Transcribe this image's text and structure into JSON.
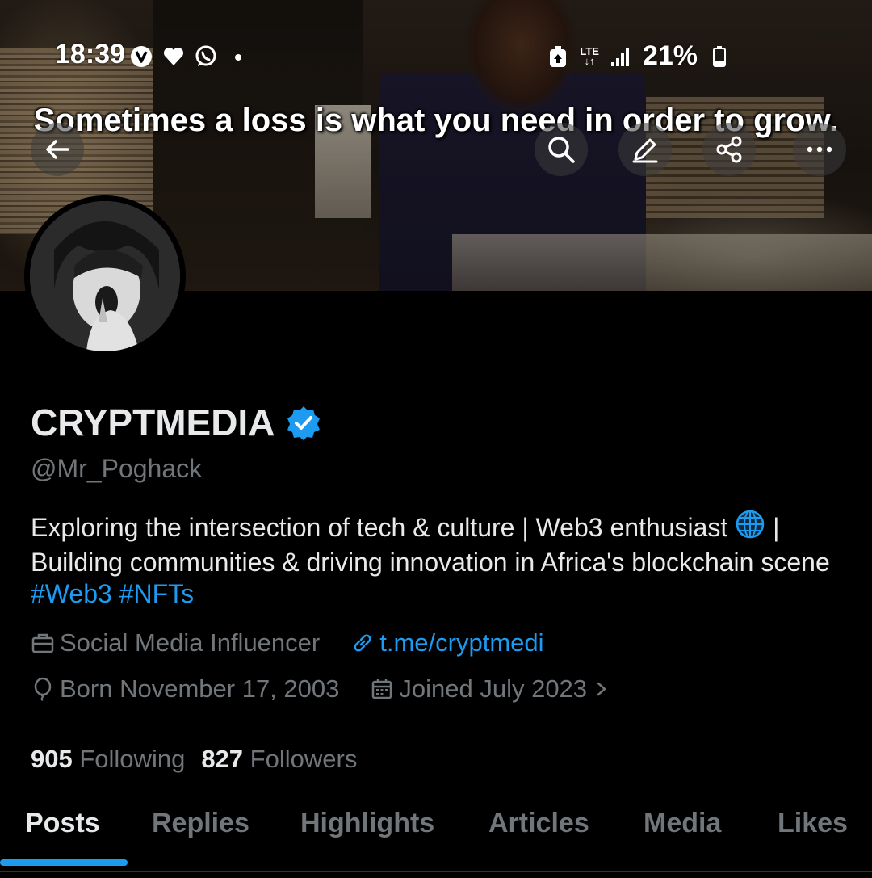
{
  "status_bar": {
    "time": "18:39",
    "battery": "21%",
    "network": "LTE",
    "icons": [
      "verizon-icon",
      "heart-icon",
      "whatsapp-icon",
      "dot-icon",
      "battery-saver-icon",
      "signal-icon",
      "battery-icon"
    ]
  },
  "banner": {
    "caption": "Sometimes a loss is what you need in order to grow."
  },
  "top_actions": [
    "back-icon",
    "search-icon",
    "edit-icon",
    "share-icon",
    "more-icon"
  ],
  "profile": {
    "display_name": "CRYPTMEDIA",
    "verified": true,
    "handle": "@Mr_Poghack",
    "bio_text": "Exploring the intersection of tech & culture | Web3 enthusiast",
    "bio_text_2": "| Building communities & driving innovation in Africa's blockchain scene",
    "hashtags": [
      "#Web3",
      "#NFTs"
    ],
    "category": "Social Media Influencer",
    "link": "t.me/cryptmedi",
    "born": "Born November 17, 2003",
    "joined": "Joined July 2023",
    "following_count": "905",
    "following_label": "Following",
    "followers_count": "827",
    "followers_label": "Followers"
  },
  "tabs": [
    {
      "label": "Posts",
      "active": true
    },
    {
      "label": "Replies",
      "active": false
    },
    {
      "label": "Highlights",
      "active": false
    },
    {
      "label": "Articles",
      "active": false
    },
    {
      "label": "Media",
      "active": false
    },
    {
      "label": "Likes",
      "active": false
    }
  ],
  "colors": {
    "accent": "#1d9bf0",
    "background": "#000000",
    "text_primary": "#e7e9ea",
    "text_secondary": "#71767b"
  }
}
